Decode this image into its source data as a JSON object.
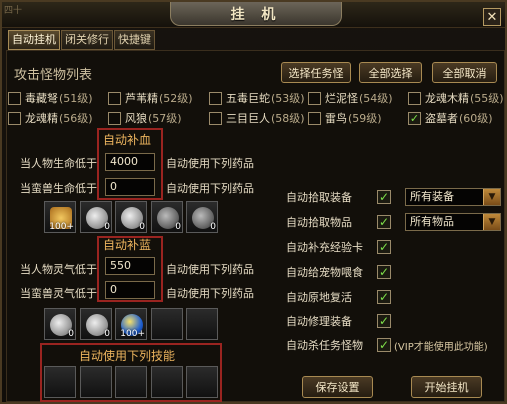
{
  "window": {
    "corner_text": "四十",
    "title": "挂 机",
    "close_symbol": "✕"
  },
  "tabs": [
    {
      "label": "自动挂机",
      "active": true
    },
    {
      "label": "闭关修行",
      "active": false
    },
    {
      "label": "快捷键",
      "active": false
    }
  ],
  "monster_section": {
    "title": "攻击怪物列表",
    "buttons": {
      "select_task_monster": "选择任务怪",
      "select_all": "全部选择",
      "cancel_all": "全部取消"
    },
    "monsters": [
      {
        "name": "毒藏弩",
        "level": "(51级)",
        "checked": false
      },
      {
        "name": "芦苇精",
        "level": "(52级)",
        "checked": false
      },
      {
        "name": "五毒巨蛇",
        "level": "(53级)",
        "checked": false
      },
      {
        "name": "烂泥怪",
        "level": "(54级)",
        "checked": false
      },
      {
        "name": "龙魂木精",
        "level": "(55级)",
        "checked": false
      },
      {
        "name": "龙魂精",
        "level": "(56级)",
        "checked": false
      },
      {
        "name": "风狼",
        "level": "(57级)",
        "checked": false
      },
      {
        "name": "三目巨人",
        "level": "(58级)",
        "checked": false
      },
      {
        "name": "雷鸟",
        "level": "(59级)",
        "checked": false
      },
      {
        "name": "盗墓者",
        "level": "(60级)",
        "checked": true
      }
    ]
  },
  "hp_section": {
    "title": "自动补血",
    "rows": [
      {
        "label": "当人物生命低于",
        "value": "4000",
        "suffix": "自动使用下列药品"
      },
      {
        "label": "当蛮兽生命低于",
        "value": "0",
        "suffix": "自动使用下列药品"
      }
    ],
    "slots": [
      {
        "count": "100+",
        "icon": "medicine-bag-icon"
      },
      {
        "count": "0",
        "icon": "potion-icon"
      },
      {
        "count": "0",
        "icon": "potion-icon"
      },
      {
        "count": "0",
        "icon": "orb-icon"
      },
      {
        "count": "0",
        "icon": "orb-icon"
      }
    ]
  },
  "mp_section": {
    "title": "自动补蓝",
    "rows": [
      {
        "label": "当人物灵气低于",
        "value": "550",
        "suffix": "自动使用下列药品"
      },
      {
        "label": "当蛮兽灵气低于",
        "value": "0",
        "suffix": "自动使用下列药品"
      }
    ],
    "slots": [
      {
        "count": "0",
        "icon": "potion-icon"
      },
      {
        "count": "0",
        "icon": "potion-icon"
      },
      {
        "count": "100+",
        "icon": "blue-orb-icon"
      },
      {
        "count": "",
        "icon": ""
      },
      {
        "count": "",
        "icon": ""
      }
    ]
  },
  "skills_section": {
    "title": "自动使用下列技能",
    "slot_count": 5
  },
  "options": [
    {
      "label": "自动拾取装备",
      "checked": true,
      "select": "所有装备"
    },
    {
      "label": "自动拾取物品",
      "checked": true,
      "select": "所有物品"
    },
    {
      "label": "自动补充经验卡",
      "checked": true
    },
    {
      "label": "自动给宠物喂食",
      "checked": true
    },
    {
      "label": "自动原地复活",
      "checked": true
    },
    {
      "label": "自动修理装备",
      "checked": true
    },
    {
      "label": "自动杀任务怪物",
      "checked": true,
      "note": "(VIP才能使用此功能)"
    }
  ],
  "bottom_buttons": {
    "save": "保存设置",
    "start": "开始挂机"
  },
  "colors": {
    "accent_gold": "#a88a52",
    "highlight_red": "#9a2420",
    "check_green": "#7ee04a"
  }
}
